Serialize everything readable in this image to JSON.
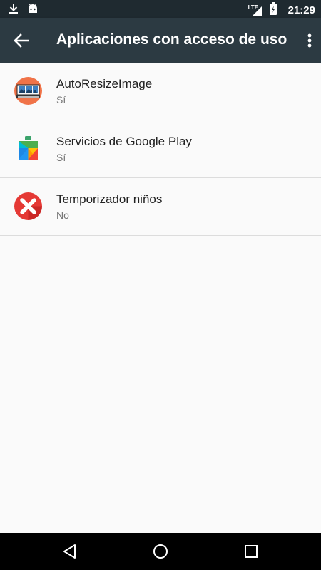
{
  "status_bar": {
    "icons_left": [
      "download-icon",
      "android-icon"
    ],
    "network_label": "LTE",
    "time": "21:29"
  },
  "toolbar": {
    "title": "Aplicaciones con acceso de uso",
    "back_icon": "arrow-back-icon",
    "overflow_icon": "more-vert-icon"
  },
  "apps": [
    {
      "name": "AutoResizeImage",
      "status": "Sí",
      "icon": "autoresize-app-icon"
    },
    {
      "name": "Servicios de Google Play",
      "status": "Sí",
      "icon": "google-play-services-icon"
    },
    {
      "name": "Temporizador niños",
      "status": "No",
      "icon": "timer-kids-app-icon"
    }
  ],
  "colors": {
    "status_bar_bg": "#1f2a30",
    "toolbar_bg": "#2c3a42",
    "list_bg": "#fafafa",
    "divider": "#dcdcdc"
  }
}
